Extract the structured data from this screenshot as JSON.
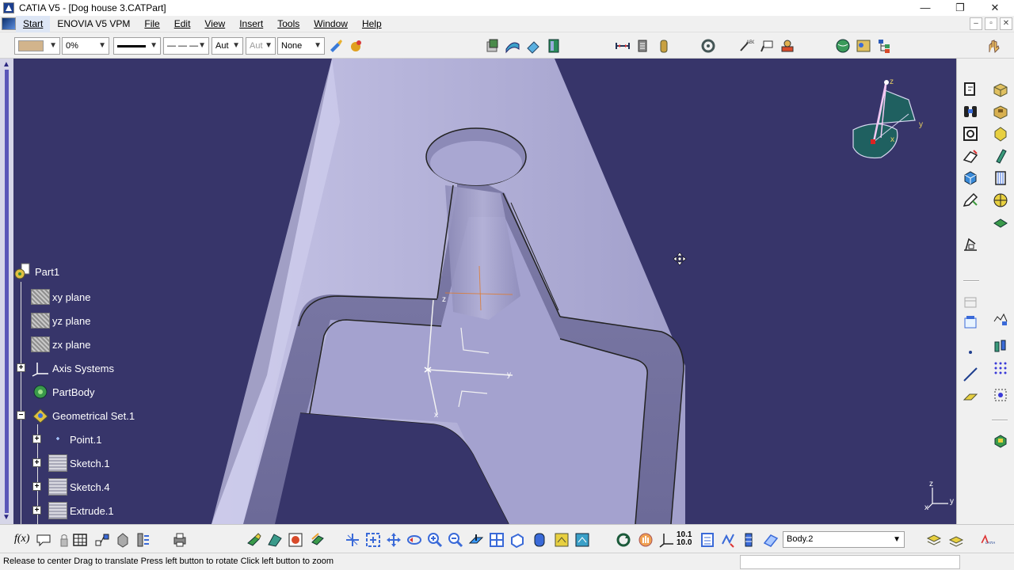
{
  "window": {
    "title": "CATIA V5 - [Dog house 3.CATPart]",
    "controls": [
      "—",
      "❐",
      "✕"
    ]
  },
  "menu": {
    "items": [
      "Start",
      "ENOVIA V5 VPM",
      "File",
      "Edit",
      "View",
      "Insert",
      "Tools",
      "Window",
      "Help"
    ],
    "mdi_controls": [
      "–",
      "▫",
      "✕"
    ]
  },
  "graphic_properties": {
    "color_value": "",
    "transparency_value": "0%",
    "line_thickness_value": "",
    "linetype_value": "— — —",
    "point_symbol_value": "Aut",
    "layer_rendering_value": "Aut",
    "layer_value": "None"
  },
  "tree": {
    "root": "Part1",
    "nodes": [
      "xy plane",
      "yz plane",
      "zx plane",
      "Axis Systems",
      "PartBody",
      "Geometrical Set.1",
      "Point.1",
      "Sketch.1",
      "Sketch.4",
      "Extrude.1"
    ],
    "expanders": {
      "axis_systems": "+",
      "geometrical_set": "−",
      "point": "+",
      "sketch1": "+",
      "sketch4": "+",
      "extrude": "+"
    }
  },
  "compass": {
    "x_label": "x",
    "y_label": "y",
    "z_label": "z"
  },
  "axis_indicator": {
    "x_label": "x",
    "y_label": "y",
    "z_label": "z"
  },
  "model_axes": {
    "x_label": "x",
    "y_label": "y",
    "z_label": "z"
  },
  "bottom_toolbar": {
    "formula_label": "f(x)",
    "body_selector_value": "Body.2",
    "zoom_label": "10.1\n10.0"
  },
  "status": {
    "message": "Release to center  Drag to translate  Press left button to rotate  Click left button to zoom"
  },
  "colors": {
    "viewport_bg": "#37356a",
    "part_face_light": "#b9b7dc",
    "part_face_mid": "#9f9dc8",
    "part_face_dark": "#7d7ba8",
    "tree_text": "#ffffff",
    "accent_orange": "#e07a2e"
  }
}
